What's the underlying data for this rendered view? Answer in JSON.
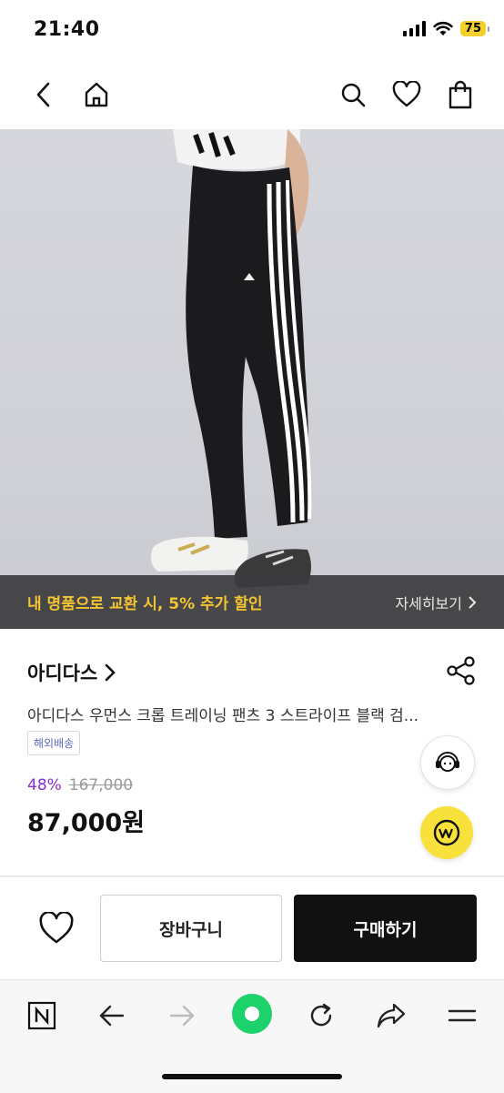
{
  "status_bar": {
    "time": "21:40",
    "battery": "75"
  },
  "promo": {
    "text": "내 명품으로 교환 시, 5% 추가 할인",
    "link_label": "자세히보기"
  },
  "product": {
    "brand": "아디다스",
    "title": "아디다스 우먼스 크롭 트레이닝 팬츠 3 스트라이프 블랙 검...",
    "shipping_badge": "해외배송",
    "discount": "48%",
    "original_price": "167,000",
    "price": "87,000원"
  },
  "actions": {
    "cart_label": "장바구니",
    "buy_label": "구매하기"
  },
  "colors": {
    "promo_text": "#f4c431",
    "discount": "#8a2ed0",
    "pay_button": "#f7e13a",
    "browser_dot": "#1ed26b"
  }
}
